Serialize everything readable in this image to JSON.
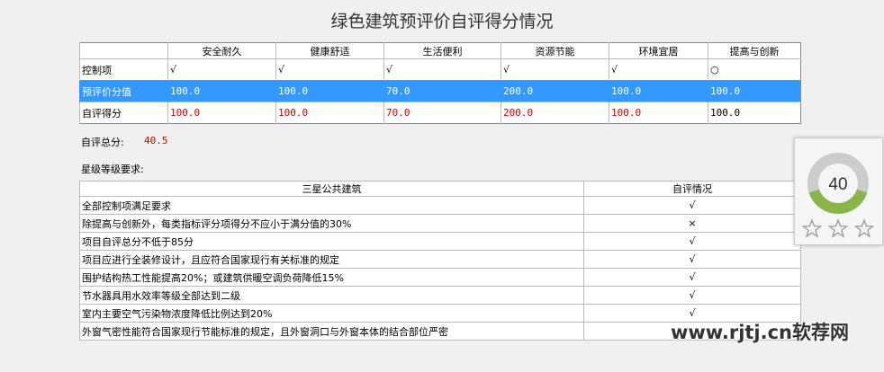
{
  "title": "绿色建筑预评价自评得分情况",
  "score_table": {
    "columns": [
      "",
      "安全耐久",
      "健康舒适",
      "生活便利",
      "资源节能",
      "环境宜居",
      "提高与创新"
    ],
    "rows": [
      {
        "label": "控制项",
        "cells": [
          "√",
          "√",
          "√",
          "√",
          "√",
          "○"
        ]
      },
      {
        "label": "预评价分值",
        "cells": [
          "100.0",
          "100.0",
          "70.0",
          "200.0",
          "100.0",
          "100.0"
        ]
      },
      {
        "label": "自评得分",
        "cells": [
          "100.0",
          "100.0",
          "70.0",
          "200.0",
          "100.0",
          "100.0"
        ]
      }
    ]
  },
  "total": {
    "label": "自评总分:",
    "value": "40.5"
  },
  "star_section": {
    "title": "星级等级要求:"
  },
  "req_table": {
    "headers": [
      "三星公共建筑",
      "自评情况"
    ],
    "rows": [
      {
        "text": "全部控制项满足要求",
        "mark": "√"
      },
      {
        "text": "除提高与创新外，每类指标评分项得分不应小于满分值的30%",
        "mark": "×"
      },
      {
        "text": "项目自评总分不低于85分",
        "mark": "√"
      },
      {
        "text": "项目应进行全装修设计，且应符合国家现行有关标准的规定",
        "mark": "√"
      },
      {
        "text": "围护结构热工性能提高20%；或建筑供暖空调负荷降低15%",
        "mark": "√"
      },
      {
        "text": "节水器具用水效率等级全部达到二级",
        "mark": "√"
      },
      {
        "text": "室内主要空气污染物浓度降低比例达到20%",
        "mark": "√"
      },
      {
        "text": "外窗气密性能符合国家现行节能标准的规定，且外窗洞口与外窗本体的结合部位严密",
        "mark": ""
      }
    ]
  },
  "widget": {
    "score": "40",
    "progress_fraction": 0.4,
    "stars_filled": 0,
    "stars_total": 3
  },
  "watermark": "www.rjtj.cn软荐网",
  "colors": {
    "selected_row": "#3399ff",
    "red_value": "#cc0000",
    "gauge_green": "#8ab54a",
    "gauge_gray": "#cccccc"
  }
}
